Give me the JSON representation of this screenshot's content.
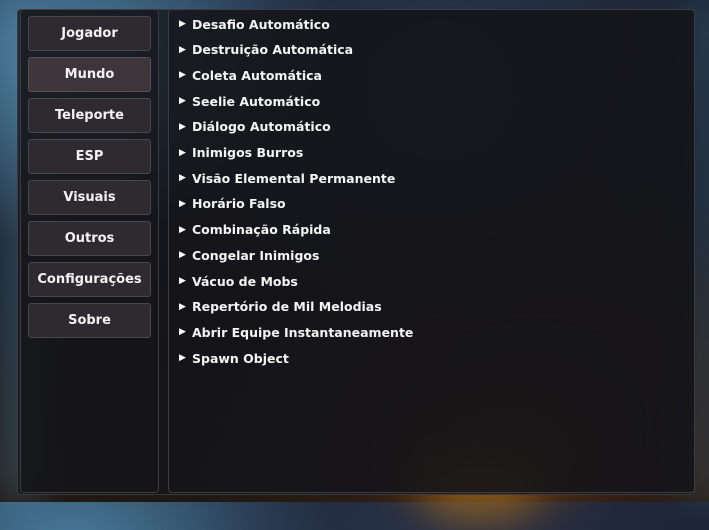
{
  "sidebar": {
    "items": [
      {
        "label": "Jogador"
      },
      {
        "label": "Mundo"
      },
      {
        "label": "Teleporte"
      },
      {
        "label": "ESP"
      },
      {
        "label": "Visuais"
      },
      {
        "label": "Outros"
      },
      {
        "label": "Configurações"
      },
      {
        "label": "Sobre"
      }
    ],
    "active_index": 1
  },
  "main": {
    "expand_glyph": "▶",
    "features": [
      {
        "label": "Desafio Automático"
      },
      {
        "label": "Destruição Automática"
      },
      {
        "label": "Coleta Automática"
      },
      {
        "label": "Seelie Automático"
      },
      {
        "label": "Diálogo Automático"
      },
      {
        "label": "Inimigos Burros"
      },
      {
        "label": "Visão Elemental Permanente"
      },
      {
        "label": "Horário Falso"
      },
      {
        "label": "Combinação Rápida"
      },
      {
        "label": "Congelar Inimigos"
      },
      {
        "label": "Vácuo de Mobs"
      },
      {
        "label": "Repertório de Mil Melodias"
      },
      {
        "label": "Abrir Equipe Instantaneamente"
      },
      {
        "label": "Spawn Object"
      }
    ]
  },
  "colors": {
    "button_bg": "#2d2b2f",
    "button_active_bg": "#3d3539",
    "text": "#f2f2f2",
    "panel_border": "#3c3c42"
  }
}
